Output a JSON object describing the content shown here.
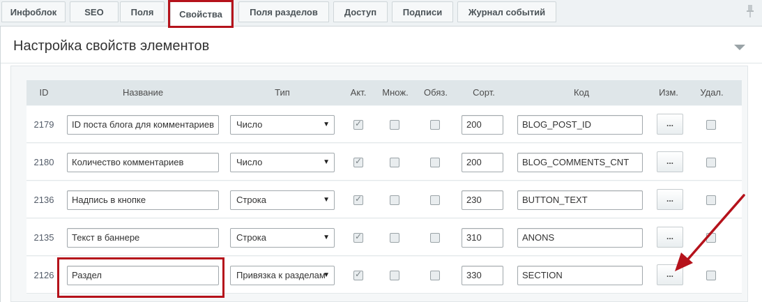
{
  "tabs": [
    {
      "label": "Инфоблок"
    },
    {
      "label": "SEO"
    },
    {
      "label": "Поля"
    },
    {
      "label": "Свойства"
    },
    {
      "label": "Поля разделов"
    },
    {
      "label": "Доступ"
    },
    {
      "label": "Подписи"
    },
    {
      "label": "Журнал событий"
    }
  ],
  "section": {
    "title": "Настройка свойств элементов"
  },
  "table": {
    "headers": {
      "id": "ID",
      "name": "Название",
      "type": "Тип",
      "active": "Акт.",
      "multiple": "Множ.",
      "required": "Обяз.",
      "sort": "Сорт.",
      "code": "Код",
      "edit": "Изм.",
      "delete": "Удал."
    },
    "rows": [
      {
        "id": "2179",
        "name": "ID поста блога для комментариев",
        "type": "Число",
        "active": true,
        "multiple": false,
        "required": false,
        "sort": "200",
        "code": "BLOG_POST_ID",
        "edit": "..."
      },
      {
        "id": "2180",
        "name": "Количество комментариев",
        "type": "Число",
        "active": true,
        "multiple": false,
        "required": false,
        "sort": "200",
        "code": "BLOG_COMMENTS_CNT",
        "edit": "..."
      },
      {
        "id": "2136",
        "name": "Надпись в кнопке",
        "type": "Строка",
        "active": true,
        "multiple": false,
        "required": false,
        "sort": "230",
        "code": "BUTTON_TEXT",
        "edit": "..."
      },
      {
        "id": "2135",
        "name": "Текст в баннере",
        "type": "Строка",
        "active": true,
        "multiple": false,
        "required": false,
        "sort": "310",
        "code": "ANONS",
        "edit": "..."
      },
      {
        "id": "2126",
        "name": "Раздел",
        "type": "Привязка к разделам",
        "active": true,
        "multiple": false,
        "required": false,
        "sort": "330",
        "code": "SECTION",
        "edit": "..."
      }
    ]
  },
  "colors": {
    "highlight": "#b5121b",
    "header_bg": "#dfe6e9",
    "tabs_bg": "#eef2f4"
  },
  "icons": {
    "pin": "pin-icon",
    "collapse": "chevron-down-icon",
    "select_caret": "caret-down-icon",
    "annotation": "arrow-annotation"
  }
}
